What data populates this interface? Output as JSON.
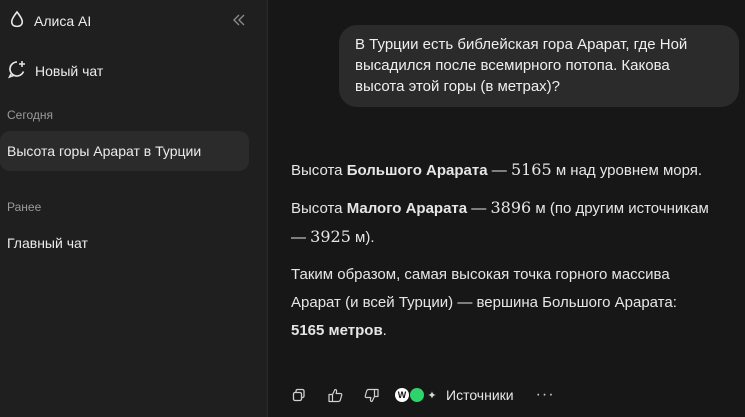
{
  "sidebar": {
    "brand": "Алиса AI",
    "new_chat": "Новый чат",
    "sections": [
      {
        "label": "Сегодня",
        "items": [
          "Высота горы Арарат в Турции"
        ]
      },
      {
        "label": "Ранее",
        "items": [
          "Главный чат"
        ]
      }
    ]
  },
  "conversation": {
    "user_message": "В Турции есть библейская гора Арарат, где Ной высадился после всемирного потопа. Какова высота этой горы (в метрах)?",
    "answer": {
      "p1": {
        "t1": "Высота ",
        "b1": "Большого Арарата",
        "t2": " — ",
        "n1": "5165",
        "t3": " м над уровнем моря."
      },
      "p2": {
        "t1": "Высота ",
        "b1": "Малого Арарата",
        "t2": " — ",
        "n1": "3896",
        "t3": " м (по другим источникам — ",
        "n2": "3925",
        "t4": " м)."
      },
      "p3": {
        "t1": "Таким образом, самая высокая точка горного массива Арарат (и всей Турции) — вершина Большого Арарата: ",
        "b1": "5165 метров",
        "t2": "."
      }
    }
  },
  "actions": {
    "sources_label": "Источники",
    "more": "···",
    "source_icons": [
      {
        "glyph": "W",
        "color": "#ffffff"
      },
      {
        "glyph": "",
        "color": "#2fd36b"
      },
      {
        "glyph": "✦",
        "color": "#d9d9d9"
      }
    ]
  }
}
